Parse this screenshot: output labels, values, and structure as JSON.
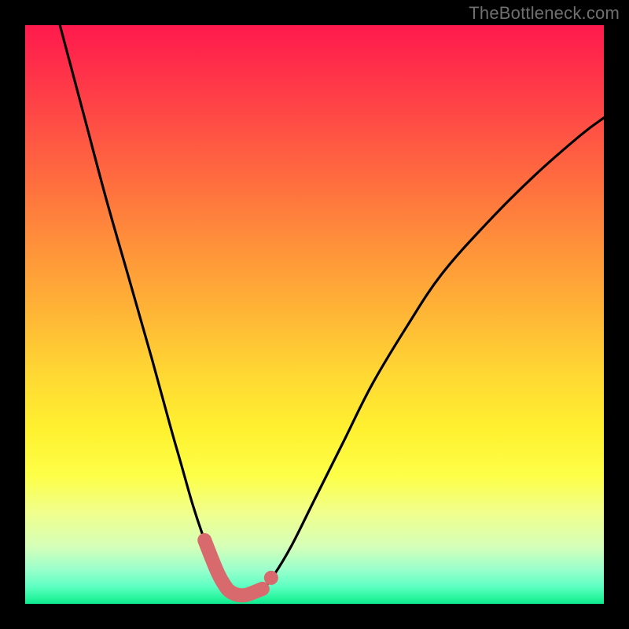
{
  "watermark": "TheBottleneck.com",
  "colors": {
    "background": "#000000",
    "curve": "#000000",
    "highlight_stroke": "#d86a6d",
    "highlight_dot": "#d86a6d"
  },
  "chart_data": {
    "type": "line",
    "title": "",
    "xlabel": "",
    "ylabel": "",
    "xlim": [
      0,
      100
    ],
    "ylim": [
      0,
      100
    ],
    "grid": false,
    "legend": false,
    "series": [
      {
        "name": "bottleneck-curve",
        "x": [
          6,
          10,
          14,
          18,
          22,
          25,
          27,
          29,
          31,
          33,
          34,
          35,
          36,
          37,
          38,
          39,
          41,
          43,
          46,
          50,
          55,
          60,
          66,
          72,
          80,
          88,
          96,
          100
        ],
        "y": [
          100,
          85,
          70,
          56,
          42,
          31,
          24,
          17,
          11,
          6,
          4,
          2.5,
          1.8,
          1.5,
          1.5,
          1.8,
          2.6,
          5,
          10,
          18,
          28,
          38,
          48,
          57,
          66,
          74,
          81,
          84
        ]
      }
    ],
    "valley": {
      "x_start": 31,
      "x_end": 41,
      "y_floor": 1.5
    },
    "annotations": [
      {
        "kind": "highlight-segment",
        "x_range": [
          31,
          41
        ]
      },
      {
        "kind": "marker-dot",
        "x": 42.5,
        "y": 4.5
      }
    ]
  }
}
